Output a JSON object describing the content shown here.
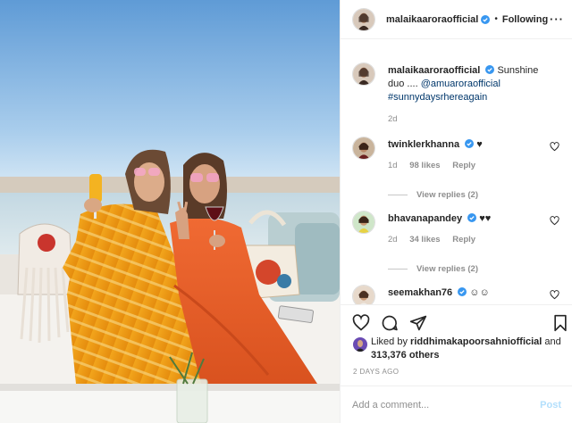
{
  "header": {
    "username": "malaikaaroraofficial",
    "separator": "•",
    "follow_status": "Following",
    "more_label": "···"
  },
  "caption": {
    "username": "malaikaaroraofficial",
    "text": "Sunshine duo ....",
    "mention": "@amuaroraofficial",
    "hashtag": "#sunnydaysrhereagain",
    "time": "2d"
  },
  "comments": [
    {
      "username": "twinklerkhanna",
      "text": "♥",
      "time": "1d",
      "likes": "98 likes",
      "reply_label": "Reply",
      "view_replies": "View replies (2)"
    },
    {
      "username": "bhavanapandey",
      "text": "♥♥",
      "time": "2d",
      "likes": "34 likes",
      "reply_label": "Reply",
      "view_replies": "View replies (2)"
    },
    {
      "username": "seemakhan76",
      "text": "☺☺"
    }
  ],
  "likes": {
    "prefix": "Liked by",
    "user": "riddhimakapoorsahniofficial",
    "and": "and",
    "count": "313,376 others"
  },
  "posted_ago": "2 DAYS AGO",
  "add_comment": {
    "placeholder": "Add a comment...",
    "post_label": "Post"
  },
  "icons": [
    "more-icon",
    "verified-icon",
    "heart-icon",
    "comment-icon",
    "share-icon",
    "bookmark-icon"
  ],
  "colors": {
    "link": "#00376b",
    "verified": "#3897f0",
    "meta": "#8e8e8e",
    "post_disabled": "#b2dffc"
  }
}
